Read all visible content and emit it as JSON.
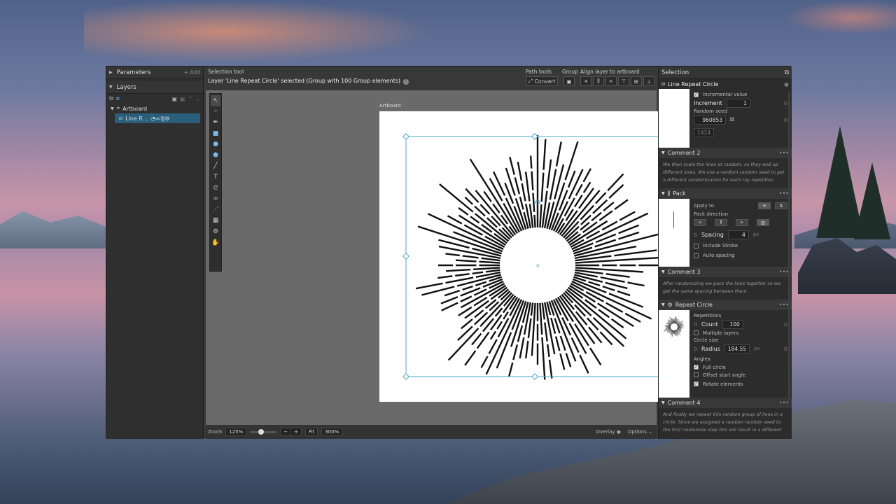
{
  "left_panel": {
    "parameters": "Parameters",
    "add": "+ Add",
    "layers": "Layers",
    "tree": {
      "artboard": "Artboard",
      "layer": "Line R..."
    }
  },
  "topbar": {
    "tool_name": "Selection tool",
    "message": "Layer 'Line Repeat Circle' selected (Group with 100 Group elements)",
    "path_tools": "Path tools",
    "convert": "Convert",
    "group": "Group",
    "align": "Align layer to artboard"
  },
  "canvas": {
    "artboard_label": "Artboard"
  },
  "bottombar": {
    "zoom_label": "Zoom",
    "zoom_value": "125%",
    "fit": "Fit",
    "zoom_300": "300%",
    "overlay": "Overlay",
    "options": "Options"
  },
  "right_panel": {
    "title": "Selection",
    "layer_name": "Line Repeat Circle",
    "incremental_value": "Incremental value",
    "increment_label": "Increment",
    "increment_value": "1",
    "random_seed_label": "Random seed",
    "random_seed_value": "960853",
    "seed_below": "1424",
    "comment2_title": "Comment 2",
    "comment2_text": "We then scale the lines at random, so they end up different sizes. We use a random random seed to get a different randomization for each ray repetition.",
    "pack_title": "Pack",
    "apply_to": "Apply to",
    "pack_direction": "Pack direction",
    "spacing_label": "Spacing",
    "spacing_value": "4",
    "spacing_unit": "px",
    "include_stroke": "Include Stroke",
    "auto_spacing": "Auto spacing",
    "comment3_title": "Comment 3",
    "comment3_text": "After randomizing we pack the lines together so we get the same spacing between them.",
    "repeat_title": "Repeat Circle",
    "repetitions": "Repetitions",
    "count_label": "Count",
    "count_value": "100",
    "multiple_layers": "Multiple layers",
    "circle_size": "Circle size",
    "radius_label": "Radius",
    "radius_value": "184.55",
    "radius_unit": "px",
    "angles": "Angles",
    "full_circle": "Full circle",
    "offset_start": "Offset start angle",
    "rotate_elements": "Rotate elements",
    "comment4_title": "Comment 4",
    "comment4_text": "And finally we repeat this random group of lines in a circle. Since we assigned a random random seed to the first randomize step this will result in a different random"
  },
  "burst": {
    "rays": 100,
    "inner_radius": 52,
    "seed": 960853
  }
}
